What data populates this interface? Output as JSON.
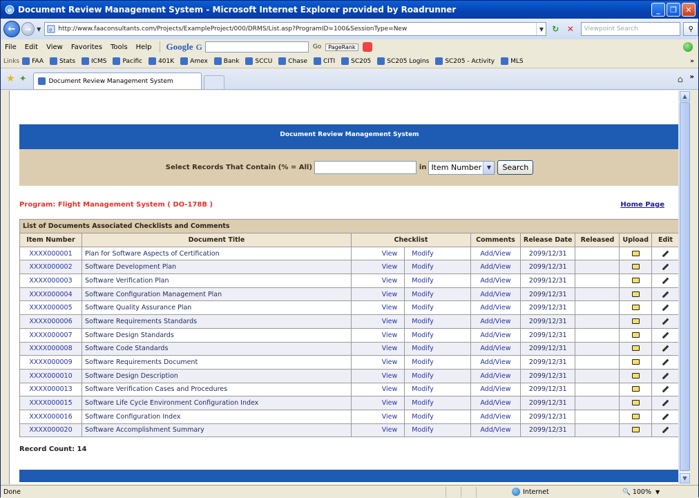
{
  "window": {
    "title": "Document Review Management System - Microsoft Internet Explorer provided by Roadrunner",
    "minimize": "_",
    "maximize": "❐",
    "close": "✕"
  },
  "addressbar": {
    "url": "http://www.faaconsultants.com/Projects/ExampleProject/000/DRMS/List.asp?ProgramID=100&SessionType=New",
    "search_placeholder": "Viewpoint Search"
  },
  "menu": {
    "items": [
      "File",
      "Edit",
      "View",
      "Favorites",
      "Tools",
      "Help"
    ],
    "google": "Google",
    "google_g": "G",
    "go": "Go",
    "pagerank": "PageRank"
  },
  "links": {
    "label": "Links",
    "items": [
      "FAA",
      "Stats",
      "ICMS",
      "Pacific",
      "401K",
      "Amex",
      "Bank",
      "SCCU",
      "Chase",
      "CITI",
      "SC205",
      "SC205 Logins",
      "SC205 - Activity",
      "MLS"
    ]
  },
  "tab": {
    "title": "Document Review Management System"
  },
  "page": {
    "banner": "Document Review Management System",
    "search_label": "Select Records That Contain (% = All)",
    "search_in": "in",
    "search_field_option": "Item Number",
    "search_button": "Search",
    "program": "Program: Flight Management System ( DO-178B )",
    "home_link": "Home Page",
    "table_caption": "List of Documents Associated Checklists and Comments",
    "columns": [
      "Item Number",
      "Document Title",
      "Checklist",
      "Comments",
      "Release Date",
      "Released",
      "Upload",
      "Edit"
    ],
    "view_label": "View",
    "modify_label": "Modify",
    "comments_label": "Add/View",
    "rows": [
      {
        "item": "XXXX000001",
        "title": "Plan for Software Aspects of Certification",
        "date": "2099/12/31"
      },
      {
        "item": "XXXX000002",
        "title": "Software Development Plan",
        "date": "2099/12/31"
      },
      {
        "item": "XXXX000003",
        "title": "Software Verification Plan",
        "date": "2099/12/31"
      },
      {
        "item": "XXXX000004",
        "title": "Software Configuration Management Plan",
        "date": "2099/12/31"
      },
      {
        "item": "XXXX000005",
        "title": "Software Quality Assurance Plan",
        "date": "2099/12/31"
      },
      {
        "item": "XXXX000006",
        "title": "Software Requirements Standards",
        "date": "2099/12/31"
      },
      {
        "item": "XXXX000007",
        "title": "Software Design Standards",
        "date": "2099/12/31"
      },
      {
        "item": "XXXX000008",
        "title": "Software Code Standards",
        "date": "2099/12/31"
      },
      {
        "item": "XXXX000009",
        "title": "Software Requirements Document",
        "date": "2099/12/31"
      },
      {
        "item": "XXXX000010",
        "title": "Software Design Description",
        "date": "2099/12/31"
      },
      {
        "item": "XXXX000013",
        "title": "Software Verification Cases and Procedures",
        "date": "2099/12/31"
      },
      {
        "item": "XXXX000015",
        "title": "Software Life Cycle Environment Configuration Index",
        "date": "2099/12/31"
      },
      {
        "item": "XXXX000016",
        "title": "Software Configuration Index",
        "date": "2099/12/31"
      },
      {
        "item": "XXXX000020",
        "title": "Software Accomplishment Summary",
        "date": "2099/12/31"
      }
    ],
    "record_count": "Record Count: 14"
  },
  "statusbar": {
    "status": "Done",
    "zone": "Internet",
    "zoom": "100%"
  },
  "colors": {
    "banner": "#1e5cb3",
    "panel": "#dccdb0",
    "program_text": "#e8322c",
    "link_text": "#2433a1"
  }
}
